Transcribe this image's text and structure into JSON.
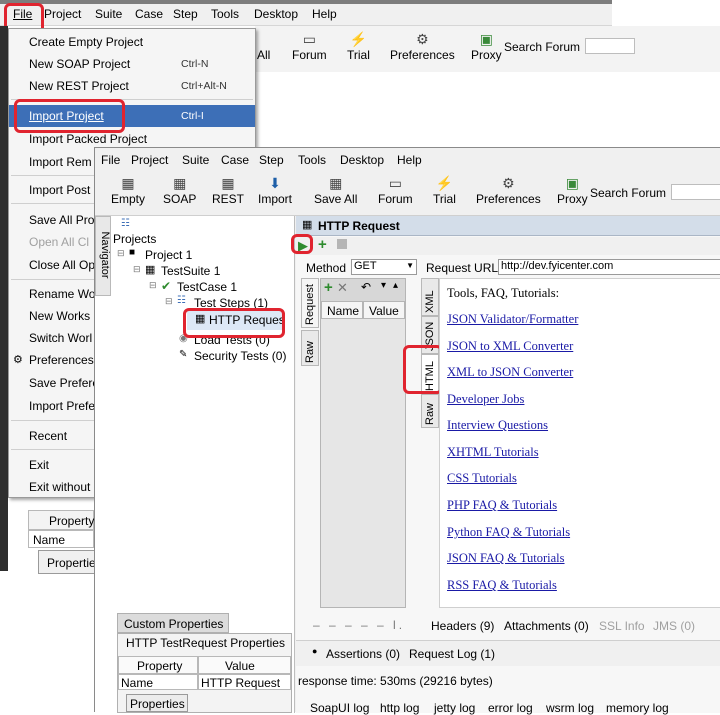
{
  "back_menu": [
    "File",
    "Project",
    "Suite",
    "Case",
    "Step",
    "Tools",
    "Desktop",
    "Help"
  ],
  "back_toolbar": {
    "all": "All",
    "forum": "Forum",
    "trial": "Trial",
    "preferences": "Preferences",
    "proxy": "Proxy",
    "search_forum": "Search Forum"
  },
  "file_menu": [
    {
      "label": "Create Empty Project",
      "shortcut": ""
    },
    {
      "label": "New SOAP Project",
      "shortcut": "Ctrl-N"
    },
    {
      "label": "New REST Project",
      "shortcut": "Ctrl+Alt-N"
    },
    {
      "label": "Import Project",
      "shortcut": "Ctrl-I"
    },
    {
      "label": "Import Packed Project",
      "shortcut": ""
    },
    {
      "label": "Import Rem",
      "shortcut": ""
    },
    {
      "label": "Import Post",
      "shortcut": ""
    },
    {
      "label": "Save All Pro",
      "shortcut": ""
    },
    {
      "label": "Open All Cl",
      "shortcut": ""
    },
    {
      "label": "Close All Op",
      "shortcut": ""
    },
    {
      "label": "Rename Wo",
      "shortcut": ""
    },
    {
      "label": "New Works",
      "shortcut": ""
    },
    {
      "label": "Switch Worl",
      "shortcut": ""
    },
    {
      "label": "Preferences",
      "shortcut": ""
    },
    {
      "label": "Save Prefere",
      "shortcut": ""
    },
    {
      "label": "Import Prefe",
      "shortcut": ""
    },
    {
      "label": "Recent",
      "shortcut": ""
    },
    {
      "label": "Exit",
      "shortcut": ""
    },
    {
      "label": "Exit without",
      "shortcut": ""
    }
  ],
  "back_props": {
    "property": "Property",
    "name": "Name",
    "properties": "Propertie"
  },
  "front_menu": [
    "File",
    "Project",
    "Suite",
    "Case",
    "Step",
    "Tools",
    "Desktop",
    "Help"
  ],
  "front_toolbar": {
    "empty": "Empty",
    "soap": "SOAP",
    "rest": "REST",
    "import": "Import",
    "save_all": "Save All",
    "forum": "Forum",
    "trial": "Trial",
    "preferences": "Preferences",
    "proxy": "Proxy",
    "search_forum": "Search Forum"
  },
  "navigator": {
    "tab": "Navigator",
    "projects": "Projects",
    "project1": "Project 1",
    "testsuite1": "TestSuite 1",
    "testcase1": "TestCase 1",
    "teststeps": "Test Steps (1)",
    "http_request": "HTTP Reques",
    "load_tests": "Load Tests (0)",
    "security_tests": "Security Tests (0)"
  },
  "custom_props": {
    "tab": "Custom Properties",
    "title": "HTTP TestRequest Properties",
    "col_property": "Property",
    "col_value": "Value",
    "row_name": "Name",
    "row_value": "HTTP Request",
    "properties_btn": "Properties"
  },
  "request": {
    "title": "HTTP Request",
    "method_label": "Method",
    "method_value": "GET",
    "url_label": "Request URL:",
    "url_value": "http://dev.fyicenter.com",
    "tab_request": "Request",
    "tab_raw": "Raw",
    "col_name": "Name",
    "col_value": "Value",
    "resp_tab_xml": "XML",
    "resp_tab_json": "JSON",
    "resp_tab_html": "HTML",
    "resp_tab_raw": "Raw",
    "heading": "Tools, FAQ, Tutorials:",
    "links": [
      "JSON Validator/Formatter",
      "JSON to XML Converter",
      "XML to JSON Converter",
      "Developer Jobs",
      "Interview Questions",
      "XHTML Tutorials",
      "CSS Tutorials",
      "PHP FAQ & Tutorials",
      "Python FAQ & Tutorials",
      "JSON FAQ & Tutorials",
      "RSS FAQ & Tutorials"
    ],
    "headers": "Headers (9)",
    "attachments": "Attachments (0)",
    "ssl": "SSL Info",
    "jms": "JMS (0)",
    "assertions": "Assertions (0)",
    "request_log": "Request Log (1)",
    "response_time": "response time: 530ms (29216 bytes)"
  },
  "logs": [
    "SoapUI log",
    "http log",
    "jetty log",
    "error log",
    "wsrm log",
    "memory log"
  ]
}
